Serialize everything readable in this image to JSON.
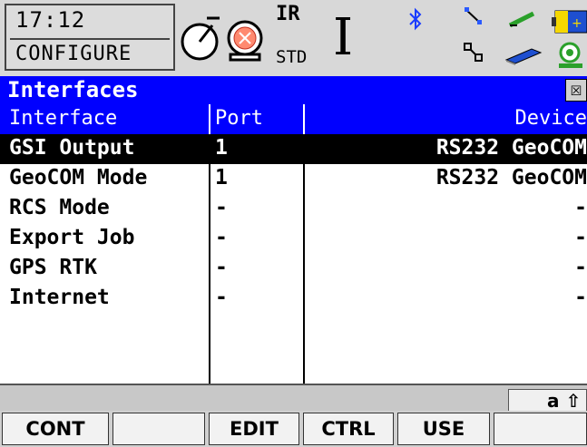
{
  "status": {
    "time": "17:12",
    "mode": "CONFIGURE",
    "ir_label": "IR",
    "std_label": "STD",
    "cursor_glyph": "I"
  },
  "title_bar": {
    "title": "Interfaces",
    "close_glyph": "☒"
  },
  "table": {
    "headers": {
      "interface": "Interface",
      "port": "Port",
      "device": "Device"
    },
    "rows": [
      {
        "interface": "GSI Output",
        "port": "1",
        "device": "RS232 GeoCOM",
        "selected": true
      },
      {
        "interface": "GeoCOM Mode",
        "port": "1",
        "device": "RS232 GeoCOM"
      },
      {
        "interface": "RCS Mode",
        "port": "-",
        "device": "-"
      },
      {
        "interface": "Export Job",
        "port": "-",
        "device": "-"
      },
      {
        "interface": "GPS RTK",
        "port": "-",
        "device": "-"
      },
      {
        "interface": "Internet",
        "port": "-",
        "device": "-"
      }
    ]
  },
  "input_mode": "a ⇧",
  "fkeys": {
    "f1": "CONT",
    "f2": "",
    "f3": "EDIT",
    "f4": "CTRL",
    "f5": "USE",
    "f6": ""
  },
  "colors": {
    "title_blue": "#0000ff",
    "selected_row": "#000000",
    "battery_yellow": "#f5d800",
    "battery_blue": "#1e4fd0",
    "green_icon": "#2aa02a",
    "red_icon": "#e04040"
  },
  "icons": [
    "compass-icon",
    "prism-icon",
    "bluetooth-icon",
    "radio-link-icon",
    "network-icon",
    "measure-icon",
    "memory-card-icon",
    "battery-icon",
    "internal-memory-icon"
  ]
}
